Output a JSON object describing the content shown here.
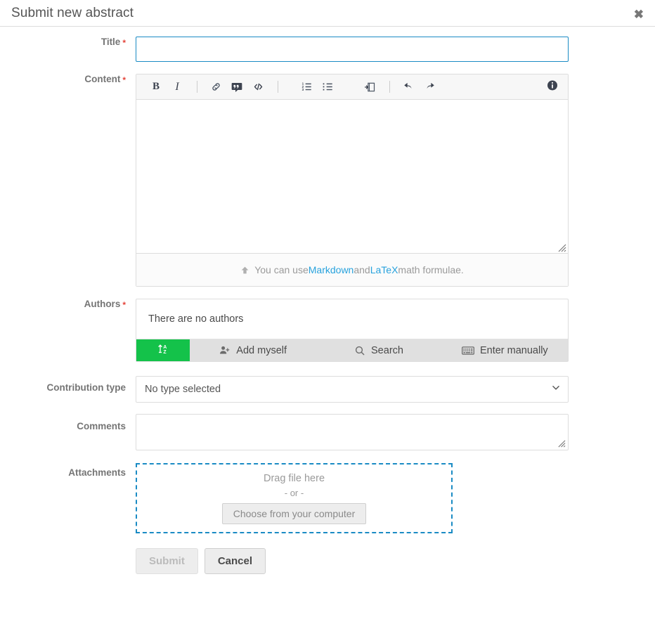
{
  "header": {
    "title": "Submit new abstract",
    "close_label": "✖"
  },
  "form": {
    "title_field": {
      "label": "Title",
      "required_mark": "*",
      "value": "",
      "placeholder": ""
    },
    "content_field": {
      "label": "Content",
      "required_mark": "*",
      "value": "",
      "placeholder": "",
      "toolbar": [
        {
          "name": "bold-icon",
          "label": "B"
        },
        {
          "name": "italic-icon",
          "label": "I"
        },
        {
          "name": "link-icon",
          "label": ""
        },
        {
          "name": "quote-icon",
          "label": ""
        },
        {
          "name": "code-icon",
          "label": "</>"
        },
        {
          "name": "ordered-list-icon",
          "label": ""
        },
        {
          "name": "unordered-list-icon",
          "label": ""
        },
        {
          "name": "insert-image-icon",
          "label": ""
        },
        {
          "name": "undo-icon",
          "label": ""
        },
        {
          "name": "redo-icon",
          "label": ""
        },
        {
          "name": "info-icon",
          "label": ""
        }
      ],
      "help": {
        "prefix": "You can use ",
        "link1": "Markdown",
        "middle": " and ",
        "link2": "LaTeX",
        "suffix": " math formulae."
      }
    },
    "authors_field": {
      "label": "Authors",
      "required_mark": "*",
      "empty_text": "There are no authors",
      "actions": [
        {
          "name": "sort-authors-button",
          "label": "",
          "icon": "sort-alpha-down-icon"
        },
        {
          "name": "add-myself-button",
          "label": "Add myself",
          "icon": "user-plus-icon"
        },
        {
          "name": "search-author-button",
          "label": "Search",
          "icon": "search-icon"
        },
        {
          "name": "enter-manually-button",
          "label": "Enter manually",
          "icon": "keyboard-icon"
        }
      ]
    },
    "contribution_type_field": {
      "label": "Contribution type",
      "selected": "No type selected",
      "options": [
        "No type selected"
      ]
    },
    "comments_field": {
      "label": "Comments",
      "value": "",
      "placeholder": ""
    },
    "attachments_field": {
      "label": "Attachments",
      "drag_text": "Drag file here",
      "or_text": "- or -",
      "choose_button": "Choose from your computer"
    }
  },
  "footer": {
    "submit_label": "Submit",
    "cancel_label": "Cancel"
  },
  "colors": {
    "accent_blue": "#1a8bc4",
    "link_blue": "#27a2dd",
    "green": "#14c24a",
    "required_red": "#e4443a",
    "label_gray": "#757575"
  }
}
